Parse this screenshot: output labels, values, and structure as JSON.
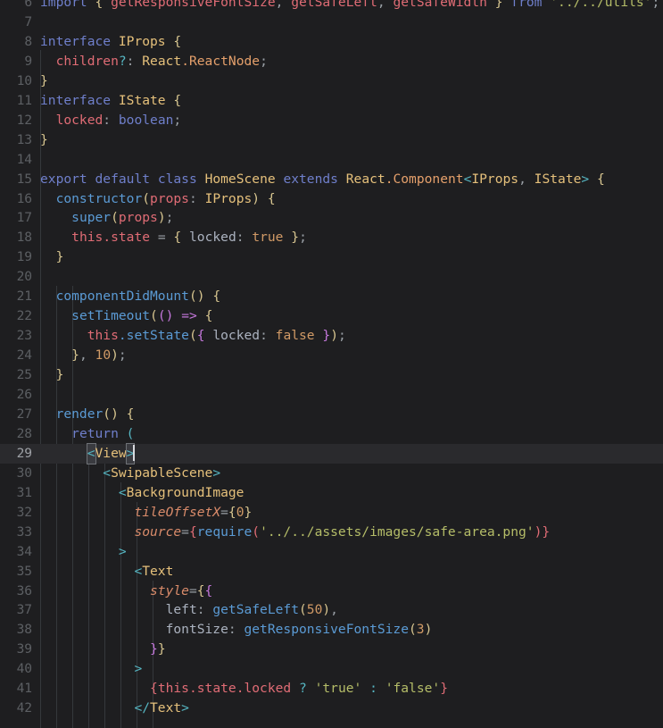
{
  "editor": {
    "background": "#1e1e20",
    "active_line_background": "#2a2a2d",
    "gutter_color": "#5c5f63",
    "first_visible_line": 6,
    "last_visible_line": 42,
    "active_line_number": 29,
    "language": "TypeScript React",
    "indent_guide_color": "#35383c"
  },
  "lines": [
    {
      "num": "6",
      "text": "import { getResponsiveFontSize, getSafeLeft, getSafeWidth } from '../../utils';"
    },
    {
      "num": "7",
      "text": ""
    },
    {
      "num": "8",
      "text": "interface IProps {"
    },
    {
      "num": "9",
      "text": "  children?: React.ReactNode;"
    },
    {
      "num": "10",
      "text": "}"
    },
    {
      "num": "11",
      "text": "interface IState {"
    },
    {
      "num": "12",
      "text": "  locked: boolean;"
    },
    {
      "num": "13",
      "text": "}"
    },
    {
      "num": "14",
      "text": ""
    },
    {
      "num": "15",
      "text": "export default class HomeScene extends React.Component<IProps, IState> {"
    },
    {
      "num": "16",
      "text": "  constructor(props: IProps) {"
    },
    {
      "num": "17",
      "text": "    super(props);"
    },
    {
      "num": "18",
      "text": "    this.state = { locked: true };"
    },
    {
      "num": "19",
      "text": "  }"
    },
    {
      "num": "20",
      "text": ""
    },
    {
      "num": "21",
      "text": "  componentDidMount() {"
    },
    {
      "num": "22",
      "text": "    setTimeout(() => {"
    },
    {
      "num": "23",
      "text": "      this.setState({ locked: false });"
    },
    {
      "num": "24",
      "text": "    }, 10);"
    },
    {
      "num": "25",
      "text": "  }"
    },
    {
      "num": "26",
      "text": ""
    },
    {
      "num": "27",
      "text": "  render() {"
    },
    {
      "num": "28",
      "text": "    return ("
    },
    {
      "num": "29",
      "text": "      <View>"
    },
    {
      "num": "30",
      "text": "        <SwipableScene>"
    },
    {
      "num": "31",
      "text": "          <BackgroundImage"
    },
    {
      "num": "32",
      "text": "            tileOffsetX={0}"
    },
    {
      "num": "33",
      "text": "            source={require('../../assets/images/safe-area.png')}"
    },
    {
      "num": "34",
      "text": "          >"
    },
    {
      "num": "35",
      "text": "            <Text"
    },
    {
      "num": "36",
      "text": "              style={{"
    },
    {
      "num": "37",
      "text": "                left: getSafeLeft(50),"
    },
    {
      "num": "38",
      "text": "                fontSize: getResponsiveFontSize(3)"
    },
    {
      "num": "39",
      "text": "              }}"
    },
    {
      "num": "40",
      "text": "            >"
    },
    {
      "num": "41",
      "text": "              {this.state.locked ? 'true' : 'false'}"
    },
    {
      "num": "42",
      "text": "            </Text>"
    }
  ]
}
